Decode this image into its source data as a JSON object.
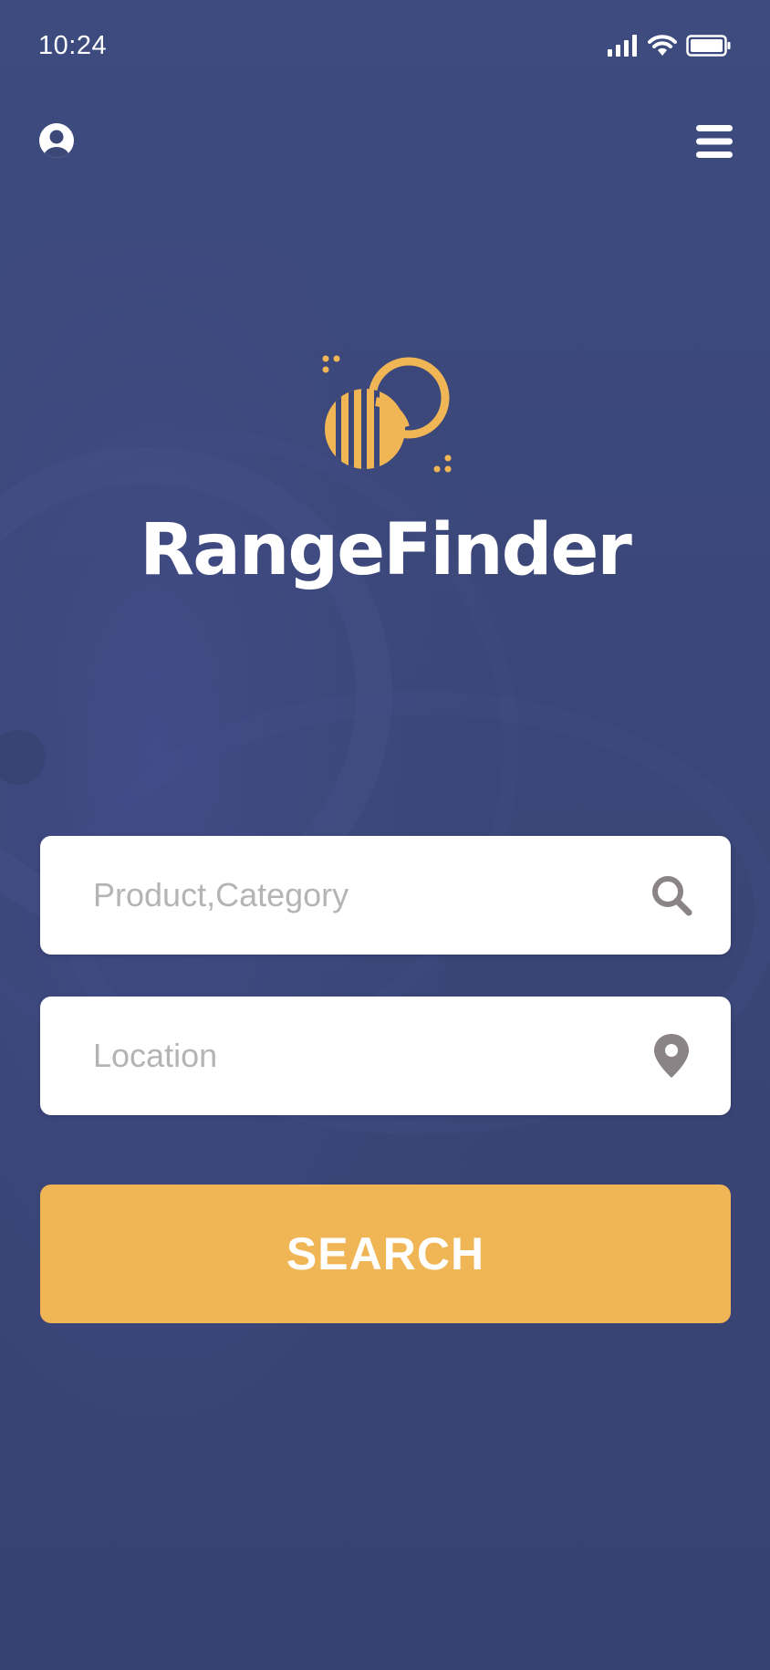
{
  "status_bar": {
    "time": "10:24",
    "icons": [
      "signal-icon",
      "wifi-icon",
      "battery-icon"
    ]
  },
  "nav": {
    "profile_icon": "user-circle-icon",
    "menu_icon": "hamburger-menu-icon"
  },
  "brand": {
    "app_name": "RangeFinder",
    "logo": "rangefinder-logo",
    "accent_color": "#f0b555"
  },
  "search_form": {
    "product_field": {
      "placeholder": "Product,Category",
      "value": "",
      "icon": "search-icon"
    },
    "location_field": {
      "placeholder": "Location",
      "value": "",
      "icon": "map-pin-icon"
    },
    "submit_label": "SEARCH"
  },
  "colors": {
    "background": "#3b4778",
    "field_background": "#ffffff",
    "placeholder": "#b4b4b4",
    "field_icon": "#8a8486",
    "button": "#f0b555",
    "button_text": "#ffffff"
  }
}
